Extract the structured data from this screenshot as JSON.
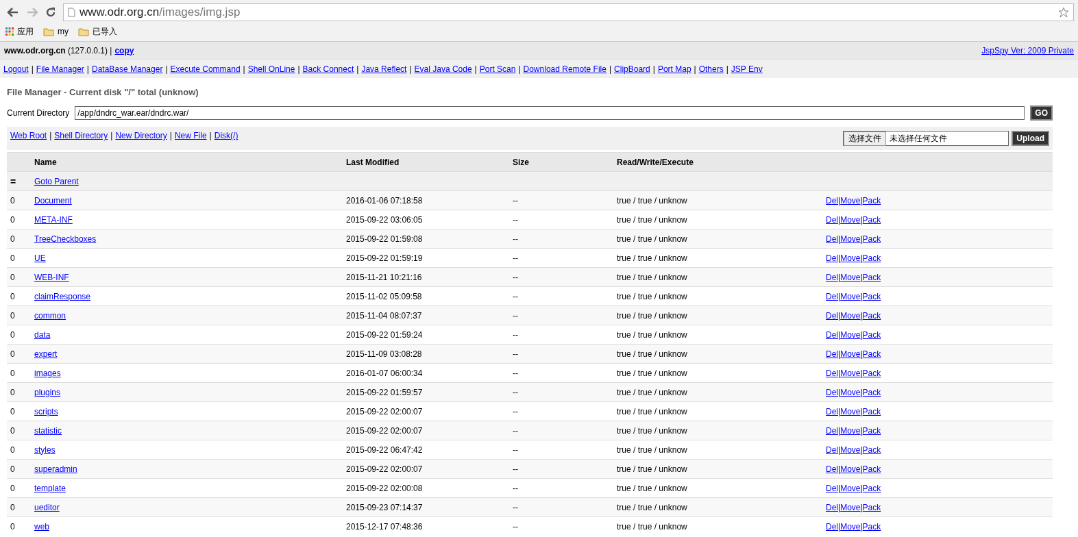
{
  "browser": {
    "url_host": "www.odr.org.cn",
    "url_path": "/images/img.jsp",
    "bookmarks": [
      {
        "kind": "apps",
        "label": "应用"
      },
      {
        "kind": "folder",
        "label": "my"
      },
      {
        "kind": "folder",
        "label": "已导入"
      }
    ]
  },
  "info_bar": {
    "host": "www.odr.org.cn",
    "ip": "(127.0.0.1)",
    "copy_link": "copy",
    "version_link": "JspSpy Ver: 2009 Private",
    "separator": "|"
  },
  "link_separator": "|",
  "nav_links": [
    "Logout",
    "File Manager",
    "DataBase Manager",
    "Execute Command",
    "Shell OnLine",
    "Back Connect",
    "Java Reflect",
    "Eval Java Code",
    "Port Scan",
    "Download Remote File",
    "ClipBoard",
    "Port Map",
    "Others",
    "JSP Env"
  ],
  "title": "File Manager - Current disk \"/\" total (unknow)",
  "current_directory": {
    "label": "Current Directory",
    "value": "/app/dndrc_war.ear/dndrc.war/",
    "button": "GO"
  },
  "toolbar_links": [
    "Web Root",
    "Shell Directory",
    "New Directory",
    "New File",
    "Disk(/)"
  ],
  "upload": {
    "choose_button": "选择文件",
    "file_status": "未选择任何文件",
    "button": "Upload"
  },
  "table": {
    "columns": [
      "Name",
      "Last Modified",
      "Size",
      "Read/Write/Execute"
    ],
    "parent_row": {
      "icon": "=",
      "link": "Goto Parent"
    },
    "rows": [
      {
        "icon": "0",
        "name": "Document",
        "modified": "2016-01-06 07:18:58",
        "size": "--",
        "rwx": "true / true / unknow",
        "actions": [
          "Del",
          "Move",
          "Pack"
        ]
      },
      {
        "icon": "0",
        "name": "META-INF",
        "modified": "2015-09-22 03:06:05",
        "size": "--",
        "rwx": "true / true / unknow",
        "actions": [
          "Del",
          "Move",
          "Pack"
        ]
      },
      {
        "icon": "0",
        "name": "TreeCheckboxes",
        "modified": "2015-09-22 01:59:08",
        "size": "--",
        "rwx": "true / true / unknow",
        "actions": [
          "Del",
          "Move",
          "Pack"
        ]
      },
      {
        "icon": "0",
        "name": "UE",
        "modified": "2015-09-22 01:59:19",
        "size": "--",
        "rwx": "true / true / unknow",
        "actions": [
          "Del",
          "Move",
          "Pack"
        ]
      },
      {
        "icon": "0",
        "name": "WEB-INF",
        "modified": "2015-11-21 10:21:16",
        "size": "--",
        "rwx": "true / true / unknow",
        "actions": [
          "Del",
          "Move",
          "Pack"
        ]
      },
      {
        "icon": "0",
        "name": "claimResponse",
        "modified": "2015-11-02 05:09:58",
        "size": "--",
        "rwx": "true / true / unknow",
        "actions": [
          "Del",
          "Move",
          "Pack"
        ]
      },
      {
        "icon": "0",
        "name": "common",
        "modified": "2015-11-04 08:07:37",
        "size": "--",
        "rwx": "true / true / unknow",
        "actions": [
          "Del",
          "Move",
          "Pack"
        ]
      },
      {
        "icon": "0",
        "name": "data",
        "modified": "2015-09-22 01:59:24",
        "size": "--",
        "rwx": "true / true / unknow",
        "actions": [
          "Del",
          "Move",
          "Pack"
        ]
      },
      {
        "icon": "0",
        "name": "expert",
        "modified": "2015-11-09 03:08:28",
        "size": "--",
        "rwx": "true / true / unknow",
        "actions": [
          "Del",
          "Move",
          "Pack"
        ]
      },
      {
        "icon": "0",
        "name": "images",
        "modified": "2016-01-07 06:00:34",
        "size": "--",
        "rwx": "true / true / unknow",
        "actions": [
          "Del",
          "Move",
          "Pack"
        ]
      },
      {
        "icon": "0",
        "name": "plugins",
        "modified": "2015-09-22 01:59:57",
        "size": "--",
        "rwx": "true / true / unknow",
        "actions": [
          "Del",
          "Move",
          "Pack"
        ]
      },
      {
        "icon": "0",
        "name": "scripts",
        "modified": "2015-09-22 02:00:07",
        "size": "--",
        "rwx": "true / true / unknow",
        "actions": [
          "Del",
          "Move",
          "Pack"
        ]
      },
      {
        "icon": "0",
        "name": "statistic",
        "modified": "2015-09-22 02:00:07",
        "size": "--",
        "rwx": "true / true / unknow",
        "actions": [
          "Del",
          "Move",
          "Pack"
        ]
      },
      {
        "icon": "0",
        "name": "styles",
        "modified": "2015-09-22 06:47:42",
        "size": "--",
        "rwx": "true / true / unknow",
        "actions": [
          "Del",
          "Move",
          "Pack"
        ]
      },
      {
        "icon": "0",
        "name": "superadmin",
        "modified": "2015-09-22 02:00:07",
        "size": "--",
        "rwx": "true / true / unknow",
        "actions": [
          "Del",
          "Move",
          "Pack"
        ]
      },
      {
        "icon": "0",
        "name": "template",
        "modified": "2015-09-22 02:00:08",
        "size": "--",
        "rwx": "true / true / unknow",
        "actions": [
          "Del",
          "Move",
          "Pack"
        ]
      },
      {
        "icon": "0",
        "name": "ueditor",
        "modified": "2015-09-23 07:14:37",
        "size": "--",
        "rwx": "true / true / unknow",
        "actions": [
          "Del",
          "Move",
          "Pack"
        ]
      },
      {
        "icon": "0",
        "name": "web",
        "modified": "2015-12-17 07:48:36",
        "size": "--",
        "rwx": "true / true / unknow",
        "actions": [
          "Del",
          "Move",
          "Pack"
        ]
      }
    ]
  }
}
